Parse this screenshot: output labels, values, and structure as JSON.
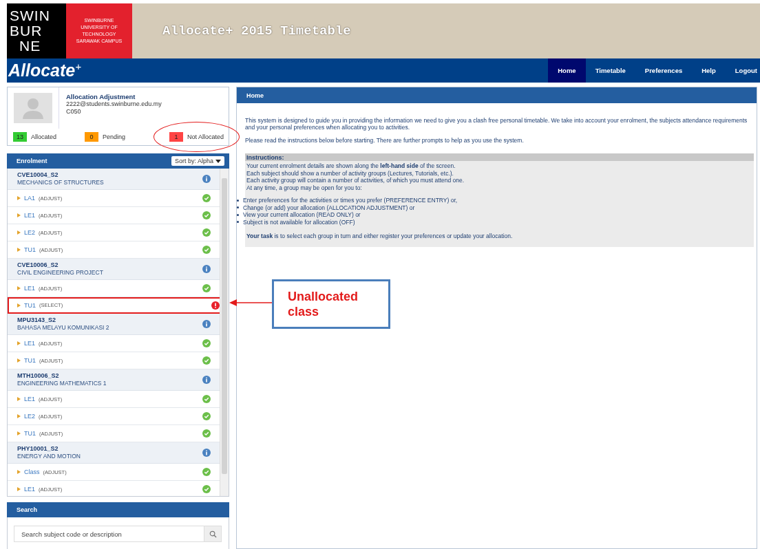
{
  "header": {
    "logo_lines": [
      "SWIN",
      "BUR",
      "NE"
    ],
    "logo_side": [
      "SWINBURNE",
      "UNIVERSITY OF",
      "TECHNOLOGY",
      "SARAWAK CAMPUS"
    ],
    "title": "Allocate+ 2015 Timetable"
  },
  "navbar": {
    "brand": "Allocate",
    "brand_sup": "+",
    "items": [
      {
        "label": "Home",
        "selected": true
      },
      {
        "label": "Timetable",
        "selected": false
      },
      {
        "label": "Preferences",
        "selected": false
      },
      {
        "label": "Help",
        "selected": false
      },
      {
        "label": "Logout",
        "selected": false
      }
    ]
  },
  "profile": {
    "mode": "Allocation Adjustment",
    "email": "2222@students.swinburne.edu.my",
    "code": "C050"
  },
  "counters": [
    {
      "count": "13",
      "label": "Allocated",
      "color": "#33cc33",
      "circled": false
    },
    {
      "count": "0",
      "label": "Pending",
      "color": "#ff9900",
      "circled": false
    },
    {
      "count": "1",
      "label": "Not Allocated",
      "color": "#ff4444",
      "circled": true
    }
  ],
  "enrolment": {
    "title": "Enrolment",
    "sort": "Sort by: Alpha",
    "items": [
      {
        "kind": "subject",
        "code": "CVE10004_S2",
        "name": "MECHANICS OF STRUCTURES"
      },
      {
        "kind": "activity",
        "name": "LA1",
        "action": "(ADJUST)",
        "allocated": true,
        "highlighted": false
      },
      {
        "kind": "activity",
        "name": "LE1",
        "action": "(ADJUST)",
        "allocated": true,
        "highlighted": false
      },
      {
        "kind": "activity",
        "name": "LE2",
        "action": "(ADJUST)",
        "allocated": true,
        "highlighted": false
      },
      {
        "kind": "activity",
        "name": "TU1",
        "action": "(ADJUST)",
        "allocated": true,
        "highlighted": false
      },
      {
        "kind": "subject",
        "code": "CVE10006_S2",
        "name": "CIVIL ENGINEERING PROJECT"
      },
      {
        "kind": "activity",
        "name": "LE1",
        "action": "(ADJUST)",
        "allocated": true,
        "highlighted": false
      },
      {
        "kind": "activity",
        "name": "TU1",
        "action": "(SELECT)",
        "allocated": false,
        "highlighted": true
      },
      {
        "kind": "subject",
        "code": "MPU3143_S2",
        "name": "BAHASA MELAYU KOMUNIKASI 2"
      },
      {
        "kind": "activity",
        "name": "LE1",
        "action": "(ADJUST)",
        "allocated": true,
        "highlighted": false
      },
      {
        "kind": "activity",
        "name": "TU1",
        "action": "(ADJUST)",
        "allocated": true,
        "highlighted": false
      },
      {
        "kind": "subject",
        "code": "MTH10006_S2",
        "name": "ENGINEERING MATHEMATICS 1"
      },
      {
        "kind": "activity",
        "name": "LE1",
        "action": "(ADJUST)",
        "allocated": true,
        "highlighted": false
      },
      {
        "kind": "activity",
        "name": "LE2",
        "action": "(ADJUST)",
        "allocated": true,
        "highlighted": false
      },
      {
        "kind": "activity",
        "name": "TU1",
        "action": "(ADJUST)",
        "allocated": true,
        "highlighted": false
      },
      {
        "kind": "subject",
        "code": "PHY10001_S2",
        "name": "ENERGY AND MOTION"
      },
      {
        "kind": "activity",
        "name": "Class",
        "action": "(ADJUST)",
        "allocated": true,
        "highlighted": false
      },
      {
        "kind": "activity",
        "name": "LE1",
        "action": "(ADJUST)",
        "allocated": true,
        "highlighted": false
      }
    ]
  },
  "search": {
    "title": "Search",
    "placeholder": "Search subject code or description"
  },
  "home": {
    "title": "Home",
    "paragraphs": [
      "This system is designed to guide you in providing the information we need to give you a clash free personal timetable. We take into account your enrolment, the subjects attendance requirements and your personal preferences when allocating you to activities.",
      "Please read the instructions below before starting. There are further prompts to help as you use the system."
    ],
    "instructions": {
      "title": "Instructions:",
      "lines": [
        "Your current enrolment details are shown along the **left-hand side** of the screen.",
        "Each subject should show a number of activity groups (Lectures, Tutorials, etc.).",
        "Each activity group will contain a number of activities, of which you must attend one.",
        "At any time, a group may be open for you to:"
      ],
      "bullets": [
        "Enter preferences for the activities or times you prefer (PREFERENCE ENTRY) or,",
        "Change (or add) your allocation (ALLOCATION ADJUSTMENT) or",
        "View your current allocation (READ ONLY) or",
        "Subject is not available for allocation (OFF)"
      ],
      "task": "**Your task** is to select each group in turn and either register your preferences or update your allocation."
    }
  },
  "callout": {
    "text": "Unallocated class"
  }
}
